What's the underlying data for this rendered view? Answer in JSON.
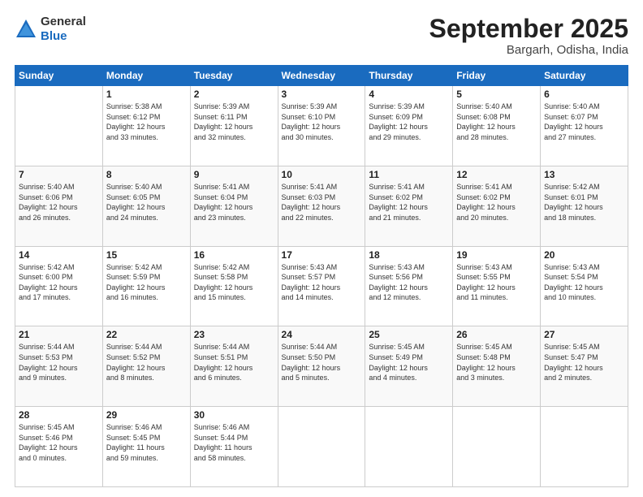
{
  "header": {
    "logo_general": "General",
    "logo_blue": "Blue",
    "title": "September 2025",
    "location": "Bargarh, Odisha, India"
  },
  "weekdays": [
    "Sunday",
    "Monday",
    "Tuesday",
    "Wednesday",
    "Thursday",
    "Friday",
    "Saturday"
  ],
  "weeks": [
    [
      {
        "day": "",
        "info": ""
      },
      {
        "day": "1",
        "info": "Sunrise: 5:38 AM\nSunset: 6:12 PM\nDaylight: 12 hours\nand 33 minutes."
      },
      {
        "day": "2",
        "info": "Sunrise: 5:39 AM\nSunset: 6:11 PM\nDaylight: 12 hours\nand 32 minutes."
      },
      {
        "day": "3",
        "info": "Sunrise: 5:39 AM\nSunset: 6:10 PM\nDaylight: 12 hours\nand 30 minutes."
      },
      {
        "day": "4",
        "info": "Sunrise: 5:39 AM\nSunset: 6:09 PM\nDaylight: 12 hours\nand 29 minutes."
      },
      {
        "day": "5",
        "info": "Sunrise: 5:40 AM\nSunset: 6:08 PM\nDaylight: 12 hours\nand 28 minutes."
      },
      {
        "day": "6",
        "info": "Sunrise: 5:40 AM\nSunset: 6:07 PM\nDaylight: 12 hours\nand 27 minutes."
      }
    ],
    [
      {
        "day": "7",
        "info": "Sunrise: 5:40 AM\nSunset: 6:06 PM\nDaylight: 12 hours\nand 26 minutes."
      },
      {
        "day": "8",
        "info": "Sunrise: 5:40 AM\nSunset: 6:05 PM\nDaylight: 12 hours\nand 24 minutes."
      },
      {
        "day": "9",
        "info": "Sunrise: 5:41 AM\nSunset: 6:04 PM\nDaylight: 12 hours\nand 23 minutes."
      },
      {
        "day": "10",
        "info": "Sunrise: 5:41 AM\nSunset: 6:03 PM\nDaylight: 12 hours\nand 22 minutes."
      },
      {
        "day": "11",
        "info": "Sunrise: 5:41 AM\nSunset: 6:02 PM\nDaylight: 12 hours\nand 21 minutes."
      },
      {
        "day": "12",
        "info": "Sunrise: 5:41 AM\nSunset: 6:02 PM\nDaylight: 12 hours\nand 20 minutes."
      },
      {
        "day": "13",
        "info": "Sunrise: 5:42 AM\nSunset: 6:01 PM\nDaylight: 12 hours\nand 18 minutes."
      }
    ],
    [
      {
        "day": "14",
        "info": "Sunrise: 5:42 AM\nSunset: 6:00 PM\nDaylight: 12 hours\nand 17 minutes."
      },
      {
        "day": "15",
        "info": "Sunrise: 5:42 AM\nSunset: 5:59 PM\nDaylight: 12 hours\nand 16 minutes."
      },
      {
        "day": "16",
        "info": "Sunrise: 5:42 AM\nSunset: 5:58 PM\nDaylight: 12 hours\nand 15 minutes."
      },
      {
        "day": "17",
        "info": "Sunrise: 5:43 AM\nSunset: 5:57 PM\nDaylight: 12 hours\nand 14 minutes."
      },
      {
        "day": "18",
        "info": "Sunrise: 5:43 AM\nSunset: 5:56 PM\nDaylight: 12 hours\nand 12 minutes."
      },
      {
        "day": "19",
        "info": "Sunrise: 5:43 AM\nSunset: 5:55 PM\nDaylight: 12 hours\nand 11 minutes."
      },
      {
        "day": "20",
        "info": "Sunrise: 5:43 AM\nSunset: 5:54 PM\nDaylight: 12 hours\nand 10 minutes."
      }
    ],
    [
      {
        "day": "21",
        "info": "Sunrise: 5:44 AM\nSunset: 5:53 PM\nDaylight: 12 hours\nand 9 minutes."
      },
      {
        "day": "22",
        "info": "Sunrise: 5:44 AM\nSunset: 5:52 PM\nDaylight: 12 hours\nand 8 minutes."
      },
      {
        "day": "23",
        "info": "Sunrise: 5:44 AM\nSunset: 5:51 PM\nDaylight: 12 hours\nand 6 minutes."
      },
      {
        "day": "24",
        "info": "Sunrise: 5:44 AM\nSunset: 5:50 PM\nDaylight: 12 hours\nand 5 minutes."
      },
      {
        "day": "25",
        "info": "Sunrise: 5:45 AM\nSunset: 5:49 PM\nDaylight: 12 hours\nand 4 minutes."
      },
      {
        "day": "26",
        "info": "Sunrise: 5:45 AM\nSunset: 5:48 PM\nDaylight: 12 hours\nand 3 minutes."
      },
      {
        "day": "27",
        "info": "Sunrise: 5:45 AM\nSunset: 5:47 PM\nDaylight: 12 hours\nand 2 minutes."
      }
    ],
    [
      {
        "day": "28",
        "info": "Sunrise: 5:45 AM\nSunset: 5:46 PM\nDaylight: 12 hours\nand 0 minutes."
      },
      {
        "day": "29",
        "info": "Sunrise: 5:46 AM\nSunset: 5:45 PM\nDaylight: 11 hours\nand 59 minutes."
      },
      {
        "day": "30",
        "info": "Sunrise: 5:46 AM\nSunset: 5:44 PM\nDaylight: 11 hours\nand 58 minutes."
      },
      {
        "day": "",
        "info": ""
      },
      {
        "day": "",
        "info": ""
      },
      {
        "day": "",
        "info": ""
      },
      {
        "day": "",
        "info": ""
      }
    ]
  ]
}
